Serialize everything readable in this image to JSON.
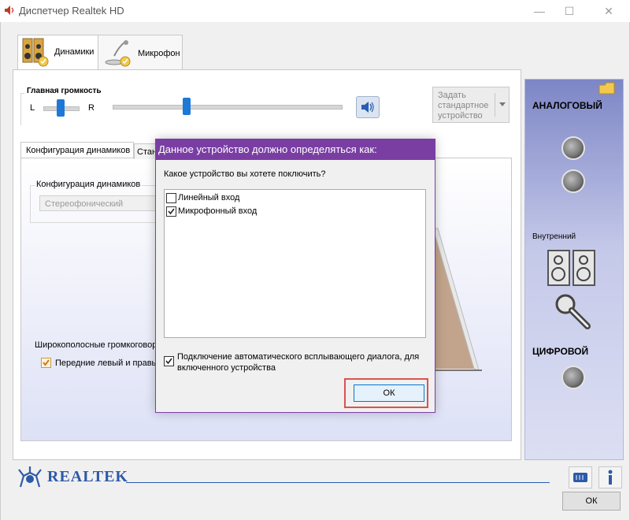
{
  "window": {
    "title": "Диспетчер Realtek HD",
    "minimize_icon": "minimize-icon",
    "maximize_icon": "maximize-icon",
    "close_icon": "close-icon"
  },
  "device_tabs": [
    {
      "label": "Динамики",
      "icon": "speakers-icon",
      "active": true
    },
    {
      "label": "Микрофон",
      "icon": "microphone-icon",
      "active": false
    }
  ],
  "main_volume": {
    "title": "Главная громкость",
    "left_label": "L",
    "right_label": "R",
    "balance_level": 0.5,
    "volume_level": 0.32
  },
  "set_default_button": {
    "label": "Задать стандартное устройство"
  },
  "inner_tabs": [
    {
      "label": "Конфигурация динамиков"
    },
    {
      "label": "Стан"
    }
  ],
  "speaker_config": {
    "group_label": "Конфигурация динамиков",
    "selected": "Стереофонический"
  },
  "broadband": {
    "label": "Широкополосные громкоговор",
    "front_checkbox_label": "Передние левый и правы",
    "checked": true
  },
  "sidebar": {
    "analog_label": "АНАЛОГОВЫЙ",
    "internal_label": "Внутренний",
    "digital_label": "ЦИФРОВОЙ"
  },
  "dialog": {
    "title": "Данное устройство должно определяться как:",
    "question": "Какое устройство вы хотете поключить?",
    "options": [
      {
        "label": "Линейный вход",
        "checked": false
      },
      {
        "label": "Микрофонный вход",
        "checked": true
      }
    ],
    "auto_popup_label": "Подключение автоматического всплывающего диалога, для включенного устройства",
    "auto_popup_checked": true,
    "ok_label": "ОК"
  },
  "brand": {
    "name": "REALTEK"
  },
  "footer": {
    "ok_label": "ОК"
  },
  "colors": {
    "dialog_title_bg": "#7a3ea3",
    "accent_blue": "#1e78d6",
    "highlight_red": "#d9534f"
  }
}
